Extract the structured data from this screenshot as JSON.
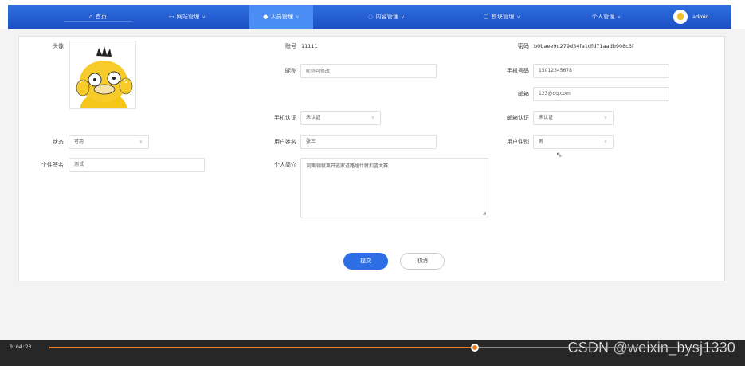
{
  "nav": {
    "home": "首页",
    "site": "网站管理",
    "people": "人员管理",
    "content": "内容管理",
    "module": "模块管理",
    "personal": "个人管理",
    "username": "admin",
    "icons": {
      "home": "home-icon",
      "site": "monitor-icon",
      "people": "user-icon",
      "content": "chat-icon",
      "module": "window-icon"
    }
  },
  "form": {
    "avatar_label": "头像",
    "account_label": "账号",
    "account_value": "11111",
    "password_label": "密码",
    "password_value": "b0baee9d279d34fa1dfd71aadb908c3f",
    "nickname_label": "昵称",
    "nickname_placeholder": "昵称可修改",
    "phone_label": "手机号码",
    "phone_value": "15012345678",
    "email_label": "邮箱",
    "email_value": "123@qq.com",
    "phone_auth_label": "手机认证",
    "phone_auth_value": "未认证",
    "email_auth_label": "邮箱认证",
    "email_auth_value": "未认证",
    "status_label": "状态",
    "status_value": "可用",
    "realname_label": "用户姓名",
    "realname_value": "张三",
    "gender_label": "用户性别",
    "gender_value": "男",
    "signature_label": "个性签名",
    "signature_value": "测试",
    "intro_label": "个人简介",
    "intro_value": "阿斯顿就离开逃家道路啥什就扣篮大赛"
  },
  "actions": {
    "submit": "提交",
    "cancel": "取消"
  },
  "video": {
    "time": "0:04:23",
    "progress": 0.628,
    "watermark": "CSDN @weixin_bysj1330"
  },
  "colors": {
    "nav": "#1b4fc4",
    "nav_active": "#4a8df5",
    "primary": "#2d6ee5",
    "progress": "#f07c22"
  }
}
